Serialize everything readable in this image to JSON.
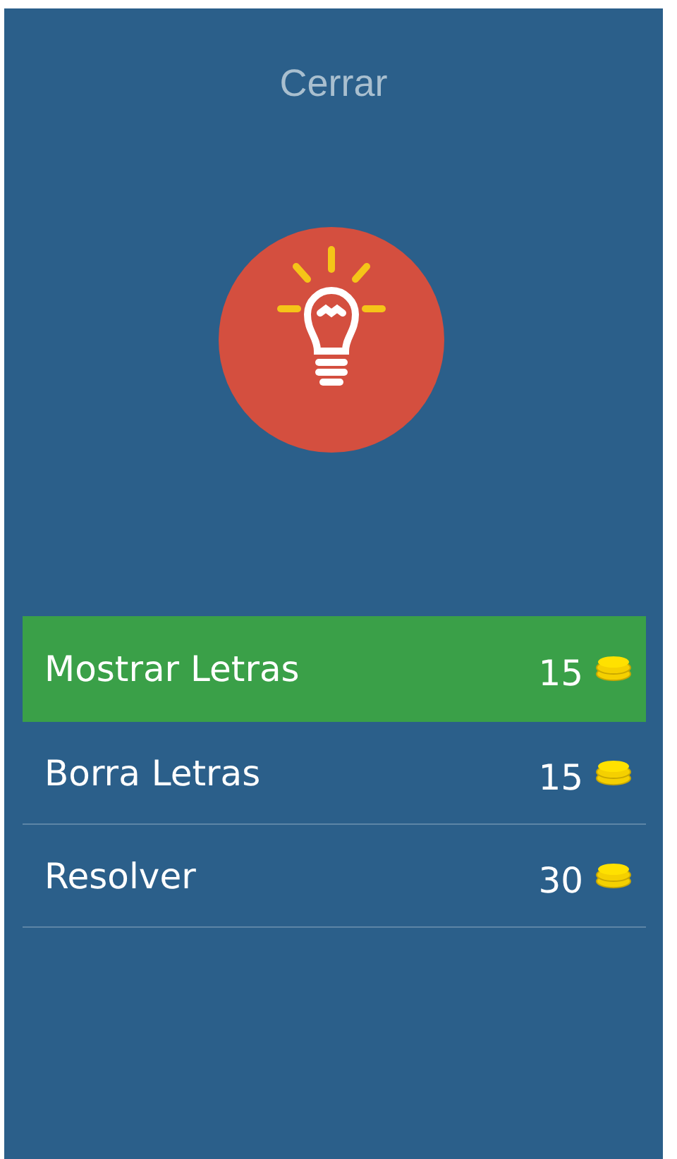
{
  "close_button": {
    "label": "Cerrar"
  },
  "options": [
    {
      "label": "Mostrar Letras",
      "cost": "15",
      "selected": true
    },
    {
      "label": "Borra Letras",
      "cost": "15",
      "selected": false
    },
    {
      "label": "Resolver",
      "cost": "30",
      "selected": false
    }
  ]
}
